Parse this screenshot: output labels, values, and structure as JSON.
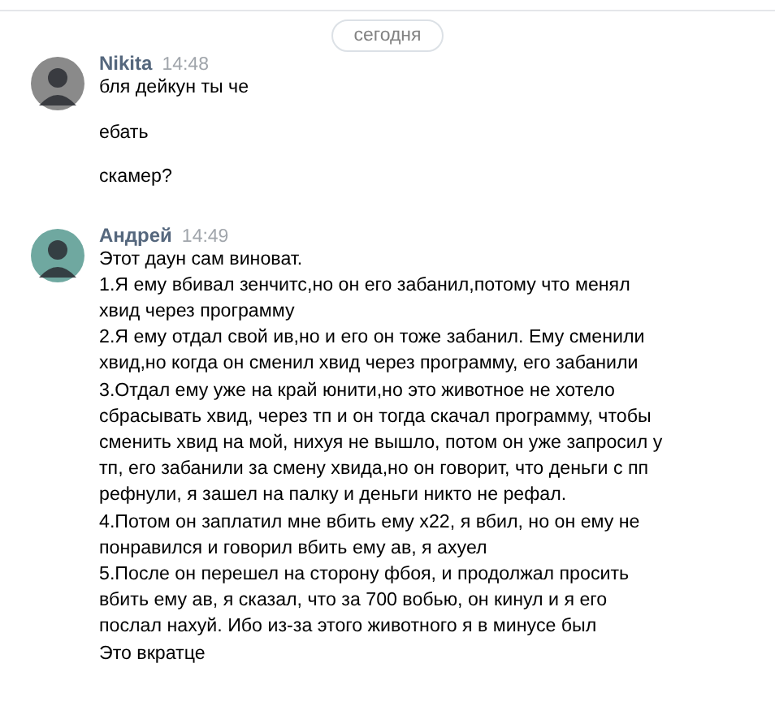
{
  "date_divider": "сегодня",
  "messages": [
    {
      "author": "Nikita",
      "time": "14:48",
      "paragraphs": [
        "бля дейкун ты че",
        "ебать",
        "скамер?"
      ],
      "spaced": true
    },
    {
      "author": "Андрей",
      "time": "14:49",
      "paragraphs": [
        "Этот даун сам виноват.",
        "1.Я ему вбивал зенчитс,но он его забанил,потому что менял хвид через программу",
        "2.Я ему отдал свой ив,но и его он тоже забанил. Ему сменили хвид,но когда он сменил хвид через программу, его забанили",
        "3.Отдал ему уже на край юнити,но это животное не хотело сбрасывать хвид, через тп и он тогда скачал программу, чтобы сменить хвид на мой, нихуя не вышло, потом он уже запросил у тп, его забанили за смену хвида,но он говорит, что деньги с пп рефнули, я зашел на палку и деньги никто не рефал.",
        "4.Потом он заплатил мне вбить ему х22, я вбил, но он ему не понравился и говорил вбить ему ав, я ахуел",
        "5.После он перешел на сторону фбоя, и продолжал просить вбить ему ав, я сказал, что за 700 вобью, он кинул и я его послал нахуй. Ибо из-за этого животного я в минусе был",
        "Это вкратце"
      ],
      "spaced": false
    }
  ]
}
